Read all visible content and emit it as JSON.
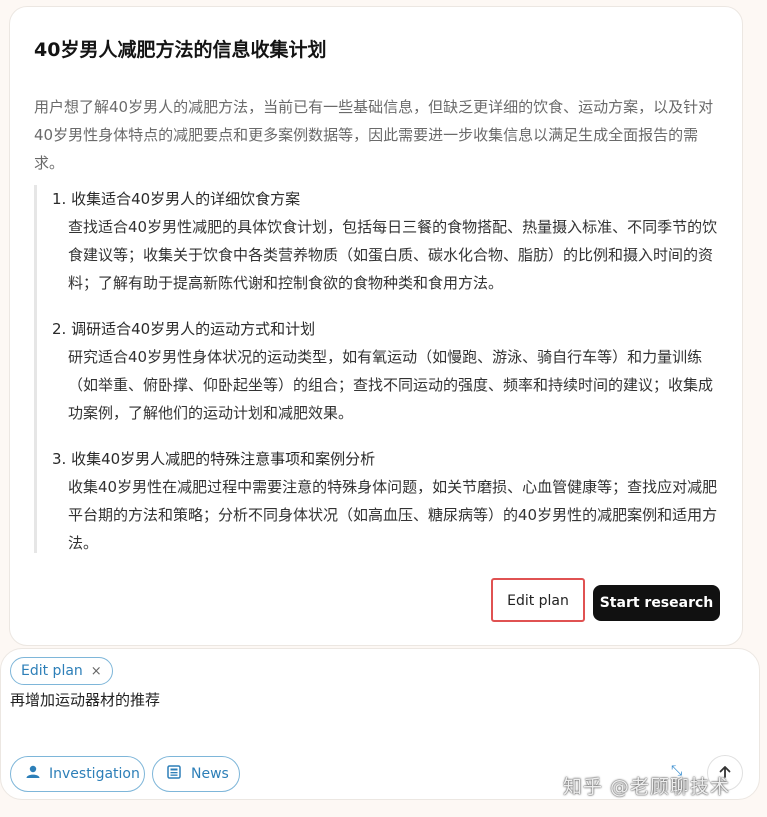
{
  "plan": {
    "title": "40岁男人减肥方法的信息收集计划",
    "intro": "用户想了解40岁男人的减肥方法，当前已有一些基础信息，但缺乏更详细的饮食、运动方案，以及针对40岁男性身体特点的减肥要点和更多案例数据等，因此需要进一步收集信息以满足生成全面报告的需求。",
    "steps": [
      {
        "title": "1. 收集适合40岁男人的详细饮食方案",
        "body": "查找适合40岁男性减肥的具体饮食计划，包括每日三餐的食物搭配、热量摄入标准、不同季节的饮食建议等；收集关于饮食中各类营养物质（如蛋白质、碳水化合物、脂肪）的比例和摄入时间的资料；了解有助于提高新陈代谢和控制食欲的食物种类和食用方法。"
      },
      {
        "title": "2. 调研适合40岁男人的运动方式和计划",
        "body": "研究适合40岁男性身体状况的运动类型，如有氧运动（如慢跑、游泳、骑自行车等）和力量训练（如举重、俯卧撑、仰卧起坐等）的组合；查找不同运动的强度、频率和持续时间的建议；收集成功案例，了解他们的运动计划和减肥效果。"
      },
      {
        "title": "3. 收集40岁男人减肥的特殊注意事项和案例分析",
        "body": "收集40岁男性在减肥过程中需要注意的特殊身体问题，如关节磨损、心血管健康等；查找应对减肥平台期的方法和策略；分析不同身体状况（如高血压、糖尿病等）的40岁男性的减肥案例和适用方法。"
      }
    ],
    "edit_label": "Edit plan",
    "start_label": "Start research"
  },
  "composer": {
    "chip_label": "Edit plan",
    "chip_close": "×",
    "text": "再增加运动器材的推荐",
    "tools": [
      {
        "label": "Investigation",
        "icon": "person-icon"
      },
      {
        "label": "News",
        "icon": "newspaper-icon"
      }
    ],
    "send_icon": "arrow-up-icon"
  },
  "watermark": "知乎 @老顾聊技术",
  "colors": {
    "accent": "#2d7fb8",
    "highlight_border": "#e05252",
    "primary_button": "#111111"
  }
}
